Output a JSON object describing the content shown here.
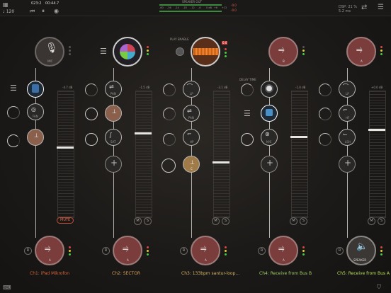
{
  "topbar": {
    "tempo": "♩ 120",
    "position": "023:2",
    "time": "00:44.7",
    "speaker_label": "SPEAKER OUT",
    "scale": [
      "-60",
      "-36",
      "-24",
      "-18",
      "-12",
      "-6",
      "0 dB",
      "+6",
      "+12"
    ],
    "peak_l": "-0.0",
    "peak_r": "-0.0",
    "dsp": "DSP: 21 %",
    "dsp_ms": "5.2 ms"
  },
  "channels": [
    {
      "name": "Ch1: iPad Mikrofon",
      "name_color": "#d8663c",
      "input": "MIC",
      "fader": "-4.7 dB",
      "nodes": [
        "",
        "FAN",
        ""
      ],
      "mute": "MUTE",
      "out": "A"
    },
    {
      "name": "Ch2: SECTOR",
      "name_color": "#d49d56",
      "input": "",
      "fader": "-1.5 dB",
      "nodes": [
        "PAN",
        "",
        "SAT"
      ],
      "out": "A"
    },
    {
      "name": "Ch3: 133bpm santur-loop...",
      "name_color": "#d4b56a",
      "input": "",
      "fader": "-3.1 dB",
      "nodes": [
        "LP",
        "PAN",
        "HP",
        "C"
      ],
      "play_label": "PLAY ENABLE",
      "rec": "0.0",
      "out": "A"
    },
    {
      "name": "Ch4: Receive from Bus B",
      "name_color": "#9fcf6a",
      "input": "B",
      "fader": "-1.0 dB",
      "nodes": [
        "",
        "",
        "M/S"
      ],
      "delay_label": "DELAY TIME",
      "out": "A"
    },
    {
      "name": "Ch5: Receive from Bus A",
      "name_color": "#b8e05a",
      "input": "A",
      "fader": "+0.0 dB",
      "nodes": [
        "LP",
        "HF",
        "LSH"
      ],
      "out": "SPEAKER"
    }
  ],
  "controls": {
    "m": "M",
    "s": "S"
  }
}
